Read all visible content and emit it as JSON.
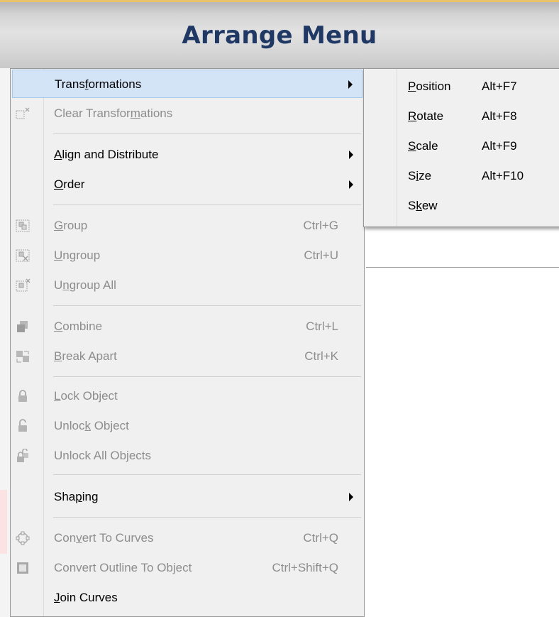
{
  "banner": {
    "title": "Arrange Menu"
  },
  "menu": {
    "items": [
      {
        "pre": "Trans",
        "u": "f",
        "post": "ormations",
        "shortcut": "",
        "arrow": true,
        "disabled": false,
        "highlight": true,
        "icon": ""
      },
      {
        "pre": "Clear Transfor",
        "u": "m",
        "post": "ations",
        "shortcut": "",
        "arrow": false,
        "disabled": true,
        "icon": "clear-transform-icon"
      },
      {
        "pre": "",
        "u": "A",
        "post": "lign and Distribute",
        "shortcut": "",
        "arrow": true,
        "disabled": false,
        "icon": ""
      },
      {
        "pre": "",
        "u": "O",
        "post": "rder",
        "shortcut": "",
        "arrow": true,
        "disabled": false,
        "icon": ""
      },
      {
        "pre": "",
        "u": "G",
        "post": "roup",
        "shortcut": "Ctrl+G",
        "arrow": false,
        "disabled": true,
        "icon": "group-icon"
      },
      {
        "pre": "",
        "u": "U",
        "post": "ngroup",
        "shortcut": "Ctrl+U",
        "arrow": false,
        "disabled": true,
        "icon": "ungroup-icon"
      },
      {
        "pre": "U",
        "u": "n",
        "post": "group All",
        "shortcut": "",
        "arrow": false,
        "disabled": true,
        "icon": "ungroup-all-icon"
      },
      {
        "pre": "",
        "u": "C",
        "post": "ombine",
        "shortcut": "Ctrl+L",
        "arrow": false,
        "disabled": true,
        "icon": "combine-icon"
      },
      {
        "pre": "",
        "u": "B",
        "post": "reak  Apart",
        "shortcut": "Ctrl+K",
        "arrow": false,
        "disabled": true,
        "icon": "break-apart-icon"
      },
      {
        "pre": "",
        "u": "L",
        "post": "ock Object",
        "shortcut": "",
        "arrow": false,
        "disabled": true,
        "icon": "lock-icon"
      },
      {
        "pre": "Unloc",
        "u": "k",
        "post": " Object",
        "shortcut": "",
        "arrow": false,
        "disabled": true,
        "icon": "unlock-icon"
      },
      {
        "pre": "Unlock All Objects",
        "u": "",
        "post": "",
        "shortcut": "",
        "arrow": false,
        "disabled": true,
        "icon": "unlock-all-icon"
      },
      {
        "pre": "Sha",
        "u": "p",
        "post": "ing",
        "shortcut": "",
        "arrow": true,
        "disabled": false,
        "icon": ""
      },
      {
        "pre": "Con",
        "u": "v",
        "post": "ert To Curves",
        "shortcut": "Ctrl+Q",
        "arrow": false,
        "disabled": true,
        "icon": "convert-curves-icon"
      },
      {
        "pre": "Convert Outline To Ob",
        "u": "j",
        "post": "ect",
        "shortcut": "Ctrl+Shift+Q",
        "arrow": false,
        "disabled": true,
        "icon": "convert-outline-icon"
      },
      {
        "pre": "",
        "u": "J",
        "post": "oin Curves",
        "shortcut": "",
        "arrow": false,
        "disabled": false,
        "icon": ""
      }
    ]
  },
  "submenu": {
    "items": [
      {
        "pre": "",
        "u": "P",
        "post": "osition",
        "shortcut": "Alt+F7"
      },
      {
        "pre": "",
        "u": "R",
        "post": "otate",
        "shortcut": "Alt+F8"
      },
      {
        "pre": "",
        "u": "S",
        "post": "cale",
        "shortcut": "Alt+F9"
      },
      {
        "pre": "S",
        "u": "i",
        "post": "ze",
        "shortcut": "Alt+F10"
      },
      {
        "pre": "S",
        "u": "k",
        "post": "ew",
        "shortcut": ""
      }
    ]
  }
}
